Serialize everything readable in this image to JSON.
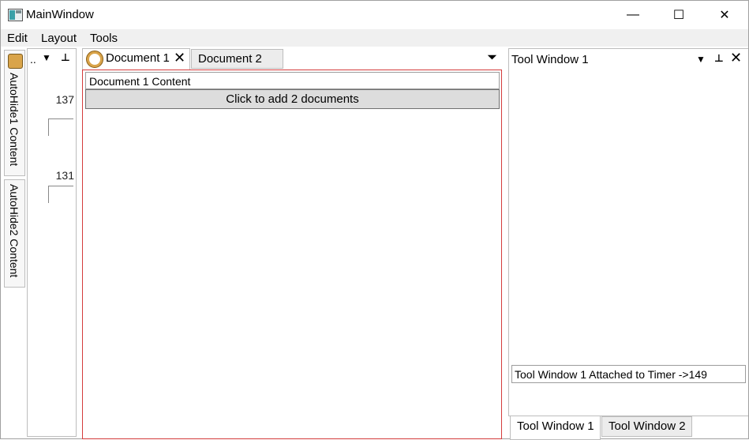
{
  "window": {
    "title": "MainWindow",
    "minimize_glyph": "—",
    "maximize_glyph": "☐",
    "close_glyph": "✕"
  },
  "menu": {
    "items": [
      "Edit",
      "Layout",
      "Tools"
    ]
  },
  "autohide": {
    "tabs": [
      {
        "label": "AutoHide1 Content",
        "icon": "autohide-app-icon"
      },
      {
        "label": "AutoHide2 Content"
      }
    ]
  },
  "left_panel": {
    "caption": "..",
    "dropdown_glyph": "▼",
    "pin_glyph": "⊥",
    "values": [
      "137",
      "131"
    ]
  },
  "documents": {
    "tabs": [
      {
        "label": "Document 1",
        "icon": "clock-icon",
        "close_glyph": "✕"
      },
      {
        "label": "Document 2"
      }
    ],
    "menu_glyph": "⏷",
    "content_text": "Document 1 Content",
    "add_button_label": "Click to add 2 documents"
  },
  "tool_window": {
    "title": "Tool Window 1",
    "dropdown_glyph": "▼",
    "pin_glyph": "⊥",
    "close_glyph": "✕",
    "status": "Tool Window 1 Attached to Timer ->149",
    "tabs": [
      "Tool Window 1",
      "Tool Window 2"
    ]
  },
  "colors": {
    "active_doc_border": "#d43c3c",
    "button_bg": "#dddddd",
    "menubar_bg": "#f0f0f0"
  }
}
